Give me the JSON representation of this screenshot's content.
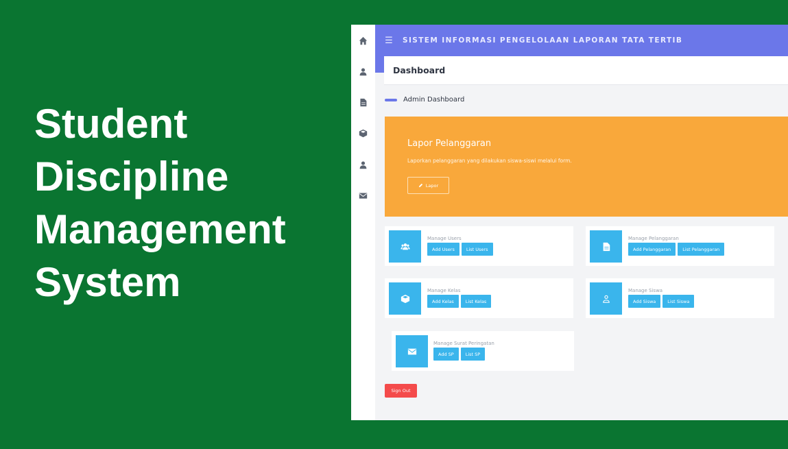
{
  "hero": {
    "line1": "Student",
    "line2": "Discipline",
    "line3": "Management",
    "line4": "System"
  },
  "colors": {
    "background": "#0a7531",
    "topbar": "#6b77e9",
    "banner": "#f9a83b",
    "card_accent": "#3ab5ec",
    "signout": "#f44b4b"
  },
  "sidebar": {
    "icons": [
      "home-icon",
      "user-icon",
      "document-icon",
      "box-icon",
      "user-icon",
      "envelope-icon"
    ]
  },
  "topbar": {
    "menu_icon": "menu-icon",
    "title": "SISTEM INFORMASI PENGELOLAAN LAPORAN TATA TERTIB"
  },
  "page": {
    "title": "Dashboard",
    "breadcrumb": "Admin Dashboard"
  },
  "banner": {
    "title": "Lapor Pelanggaran",
    "description": "Laporkan pelanggaran yang dilakukan siswa-siswi melalui form.",
    "button_label": "Lapor",
    "button_icon": "pencil-icon"
  },
  "cards": {
    "users": {
      "label": "Manage Users",
      "icon": "users-icon",
      "add": "Add Users",
      "list": "List Users"
    },
    "pelanggaran": {
      "label": "Manage Pelanggaran",
      "icon": "document-icon",
      "add": "Add Pelanggaran",
      "list": "List Pelanggaran"
    },
    "kelas": {
      "label": "Manage Kelas",
      "icon": "box-icon",
      "add": "Add Kelas",
      "list": "List Kelas"
    },
    "siswa": {
      "label": "Manage Siswa",
      "icon": "user-icon",
      "add": "Add Siswa",
      "list": "List Siswa"
    },
    "sp": {
      "label": "Manage Surat Peringatan",
      "icon": "envelope-icon",
      "add": "Add SP",
      "list": "List SP"
    }
  },
  "signout": {
    "label": "Sign Out"
  }
}
